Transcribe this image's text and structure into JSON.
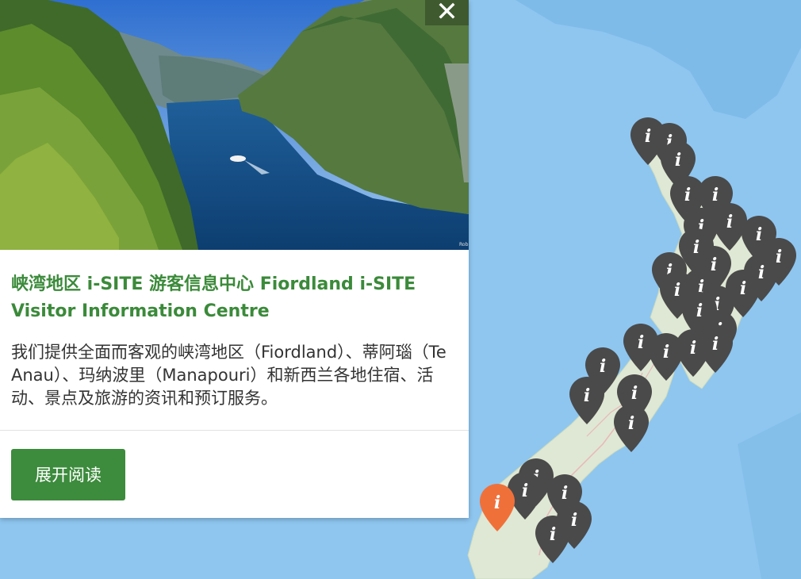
{
  "close": {
    "icon": "close-icon",
    "symbol": "✕"
  },
  "hero": {
    "photo_credit": "Rob"
  },
  "panel": {
    "title": "峡湾地区 i-SITE 游客信息中心 Fiordland i-SITE Visitor Information Centre",
    "description": "我们提供全面而客观的峡湾地区（Fiordland）、蒂阿瑙（Te Anau）、玛纳波里（Manapouri）和新西兰各地住宿、活动、景点及旅游的资讯和预订服务。",
    "read_more": "展开阅读"
  },
  "map": {
    "water_color": "#8ec6f0",
    "land_color": "#dfe8d4",
    "pin_color": "#4a4a4a",
    "selected_pin_color": "#f0703a",
    "pin_glyph": "i"
  }
}
